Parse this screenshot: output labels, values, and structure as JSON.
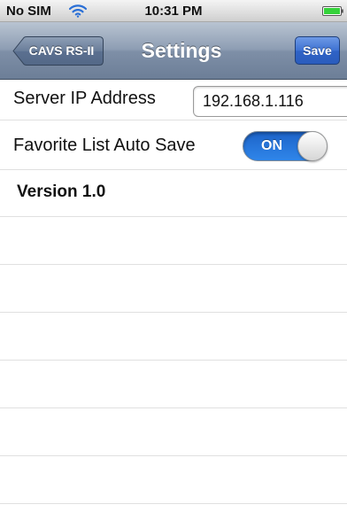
{
  "status_bar": {
    "carrier": "No SIM",
    "time": "10:31 PM",
    "wifi_icon": "wifi-icon",
    "battery_icon": "battery-icon",
    "battery_color": "#35d23a"
  },
  "nav_bar": {
    "back_label": "CAVS RS-II",
    "title": "Settings",
    "save_label": "Save",
    "save_color": "#3e72d2"
  },
  "settings": {
    "server_ip": {
      "label": "Server IP Address",
      "value": "192.168.1.116"
    },
    "auto_save": {
      "label": "Favorite List Auto Save",
      "state": "ON",
      "on_color": "#2f86ea"
    },
    "version": "Version 1.0"
  }
}
